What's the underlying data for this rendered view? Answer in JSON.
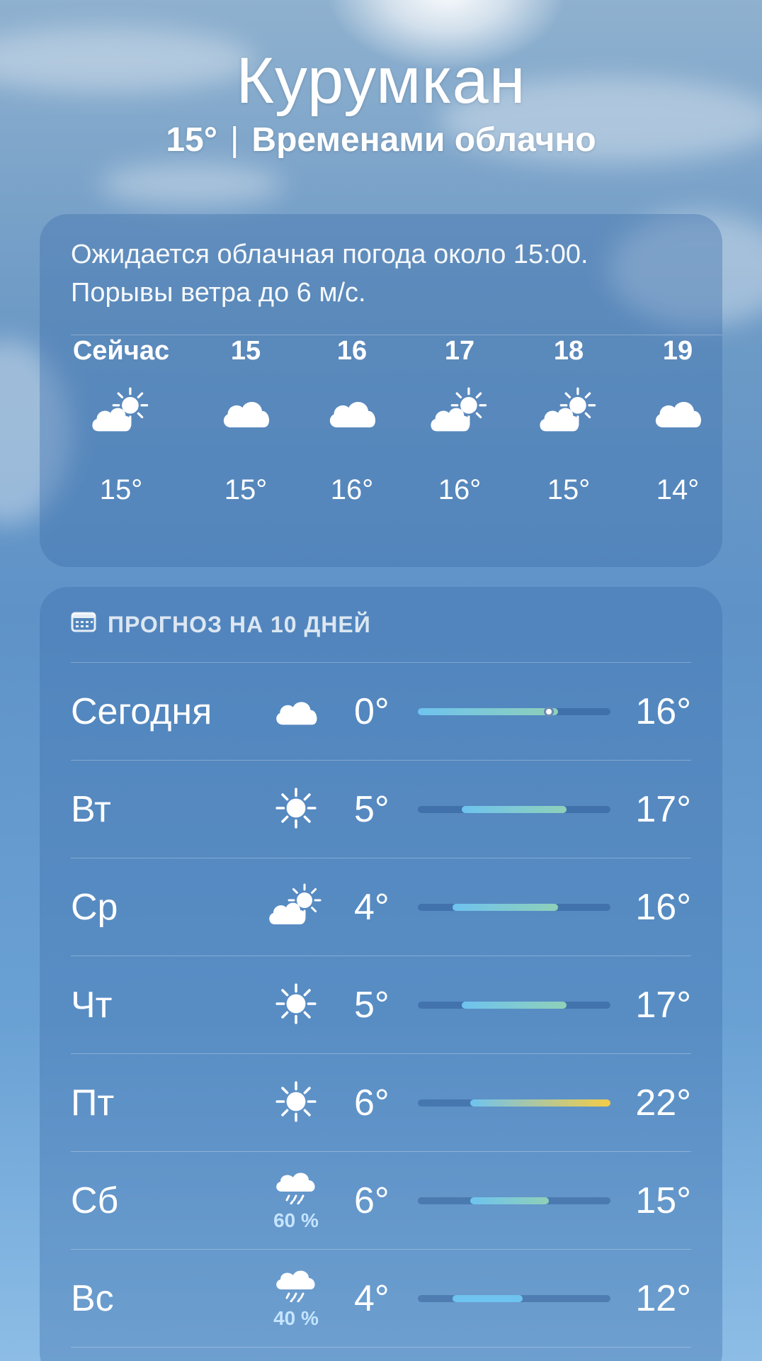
{
  "location": {
    "city": "Курумкан",
    "current_temp": "15°",
    "separator": "|",
    "condition": "Временами облачно"
  },
  "hourly": {
    "summary_line1": "Ожидается облачная погода около 15:00.",
    "summary_line2": "Порывы ветра до 6 м/с.",
    "items": [
      {
        "label": "Сейчас",
        "icon": "partly-sunny-icon",
        "temp": "15°"
      },
      {
        "label": "15",
        "icon": "cloud-icon",
        "temp": "15°"
      },
      {
        "label": "16",
        "icon": "cloud-icon",
        "temp": "16°"
      },
      {
        "label": "17",
        "icon": "partly-sunny-icon",
        "temp": "16°"
      },
      {
        "label": "18",
        "icon": "partly-sunny-icon",
        "temp": "15°"
      },
      {
        "label": "19",
        "icon": "cloud-icon",
        "temp": "14°"
      }
    ]
  },
  "daily": {
    "title": "ПРОГНОЗ НА 10 ДНЕЙ",
    "title_icon": "calendar-icon",
    "range_min": 0,
    "range_max": 22,
    "current_temp_value": 15,
    "days": [
      {
        "day": "Сегодня",
        "icon": "cloud-icon",
        "precip": "",
        "low": "0°",
        "high": "16°",
        "low_v": 0,
        "high_v": 16
      },
      {
        "day": "Вт",
        "icon": "sun-icon",
        "precip": "",
        "low": "5°",
        "high": "17°",
        "low_v": 5,
        "high_v": 17
      },
      {
        "day": "Ср",
        "icon": "partly-sunny-icon",
        "precip": "",
        "low": "4°",
        "high": "16°",
        "low_v": 4,
        "high_v": 16
      },
      {
        "day": "Чт",
        "icon": "sun-icon",
        "precip": "",
        "low": "5°",
        "high": "17°",
        "low_v": 5,
        "high_v": 17
      },
      {
        "day": "Пт",
        "icon": "sun-icon",
        "precip": "",
        "low": "6°",
        "high": "22°",
        "low_v": 6,
        "high_v": 22
      },
      {
        "day": "Сб",
        "icon": "rain-icon",
        "precip": "60 %",
        "low": "6°",
        "high": "15°",
        "low_v": 6,
        "high_v": 15
      },
      {
        "day": "Вс",
        "icon": "rain-icon",
        "precip": "40 %",
        "low": "4°",
        "high": "12°",
        "low_v": 4,
        "high_v": 12
      }
    ]
  },
  "colors": {
    "cool": "#6ec3ef",
    "mild": "#8fd0b8",
    "warm": "#f5cc45"
  }
}
